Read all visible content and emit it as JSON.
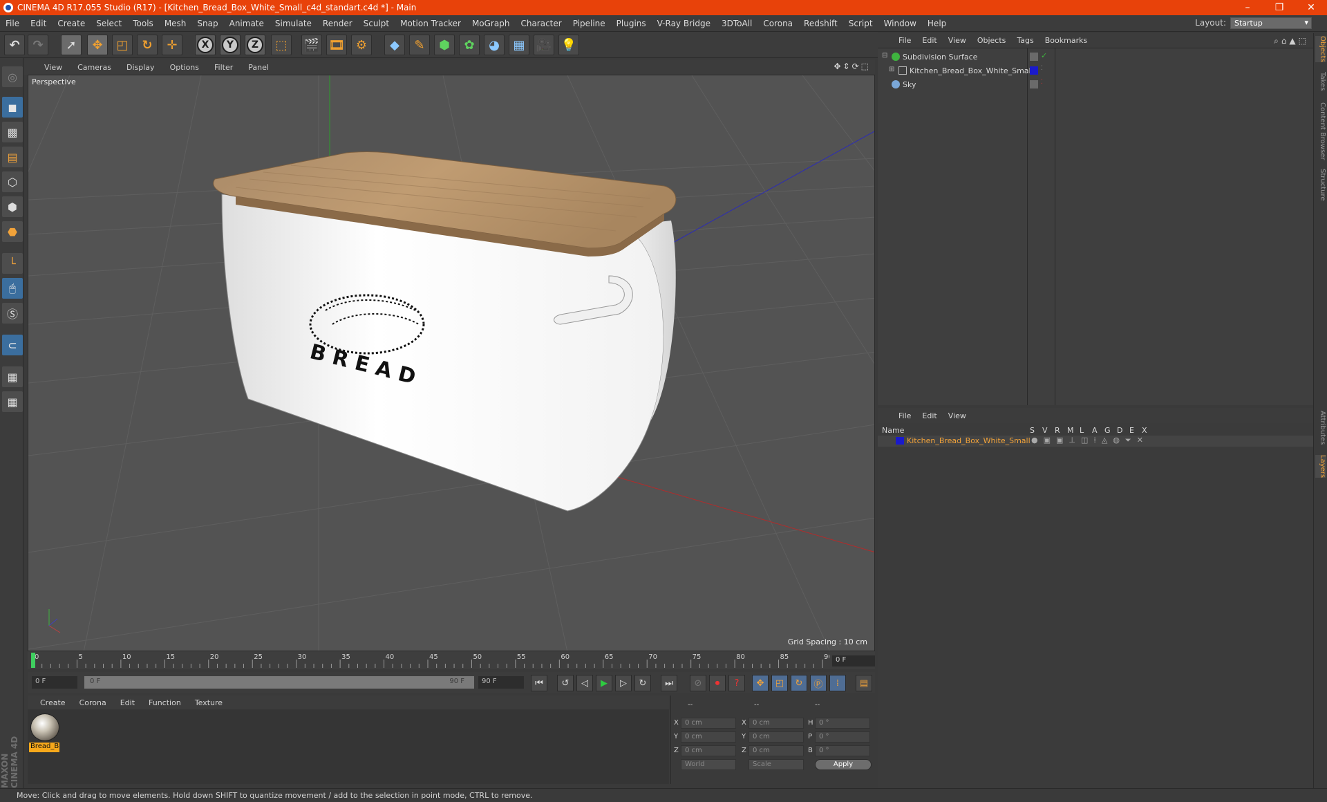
{
  "app": {
    "title": "CINEMA 4D R17.055 Studio (R17) - [Kitchen_Bread_Box_White_Small_c4d_standart.c4d *] - Main",
    "window_controls": [
      "–",
      "❐",
      "✕"
    ]
  },
  "menubar": {
    "items": [
      "File",
      "Edit",
      "Create",
      "Select",
      "Tools",
      "Mesh",
      "Snap",
      "Animate",
      "Simulate",
      "Render",
      "Sculpt",
      "Motion Tracker",
      "MoGraph",
      "Character",
      "Pipeline",
      "Plugins",
      "V-Ray Bridge",
      "3DToAll",
      "Corona",
      "Redshift",
      "Script",
      "Window",
      "Help"
    ],
    "layout_label": "Layout:",
    "layout_value": "Startup"
  },
  "toolbar": {
    "axis_x": "X",
    "axis_y": "Y",
    "axis_z": "Z"
  },
  "viewport": {
    "menu": [
      "View",
      "Cameras",
      "Display",
      "Options",
      "Filter",
      "Panel"
    ],
    "camera_label": "Perspective",
    "grid_spacing": "Grid Spacing : 10 cm",
    "box_text": "B R E A D"
  },
  "timeline": {
    "ticks": [
      "0",
      "5",
      "10",
      "15",
      "20",
      "25",
      "30",
      "35",
      "40",
      "45",
      "50",
      "55",
      "60",
      "65",
      "70",
      "75",
      "80",
      "85",
      "90"
    ],
    "current_frame": "0 F",
    "start_field": "0 F",
    "slider_start": "0 F",
    "slider_end": "90 F",
    "end_field": "90 F"
  },
  "material_manager": {
    "menu": [
      "Create",
      "Corona",
      "Edit",
      "Function",
      "Texture"
    ],
    "material_name": "Bread_B"
  },
  "coordinates": {
    "header": [
      "--",
      "--",
      "--"
    ],
    "rows": [
      {
        "l1": "X",
        "v1": "0 cm",
        "l2": "X",
        "v2": "0 cm",
        "l3": "H",
        "v3": "0 °"
      },
      {
        "l1": "Y",
        "v1": "0 cm",
        "l2": "Y",
        "v2": "0 cm",
        "l3": "P",
        "v3": "0 °"
      },
      {
        "l1": "Z",
        "v1": "0 cm",
        "l2": "Z",
        "v2": "0 cm",
        "l3": "B",
        "v3": "0 °"
      }
    ],
    "mode": "World",
    "scale_mode": "Scale",
    "apply_label": "Apply"
  },
  "object_manager": {
    "menu": [
      "File",
      "Edit",
      "View",
      "Objects",
      "Tags",
      "Bookmarks"
    ],
    "objects": [
      {
        "name": "Subdivision Surface",
        "icon_color": "#3fb33f"
      },
      {
        "name": "Kitchen_Bread_Box_White_Small",
        "icon_color": "#bcbcbc",
        "layer_color": "#1a1acc"
      },
      {
        "name": "Sky",
        "icon_color": "#7aa7d8"
      }
    ]
  },
  "layer_manager": {
    "menu": [
      "File",
      "Edit",
      "View"
    ],
    "columns": [
      "Name",
      "S",
      "V",
      "R",
      "M",
      "L",
      "A",
      "G",
      "D",
      "E",
      "X"
    ],
    "layers": [
      {
        "name": "Kitchen_Bread_Box_White_Small",
        "color": "#1a1acc",
        "text_color": "#f2a33a"
      }
    ]
  },
  "right_tabs": [
    "Objects",
    "Takes",
    "Content Browser",
    "Structure",
    "Attributes",
    "Layers"
  ],
  "status": "Move: Click and drag to move elements. Hold down SHIFT to quantize movement / add to the selection in point mode, CTRL to remove.",
  "branding": "MAXON CINEMA 4D",
  "colors": {
    "titlebar": "#e8420a",
    "accent": "#f2a33a",
    "viewport_bg": "#535353"
  }
}
